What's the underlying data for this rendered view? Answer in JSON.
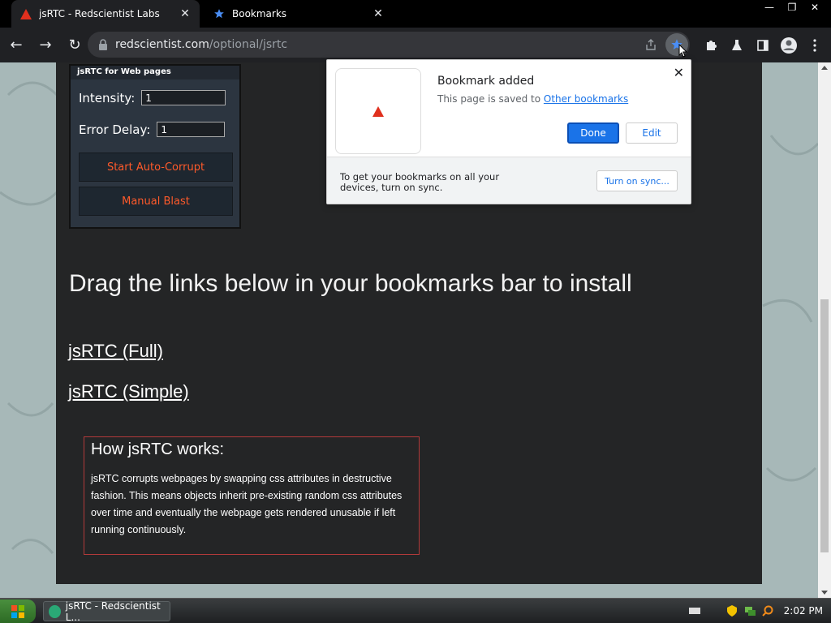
{
  "tabs": [
    {
      "title": "jsRTC - Redscientist Labs",
      "active": true
    },
    {
      "title": "Bookmarks",
      "active": false
    }
  ],
  "window_buttons": {
    "minimize": "—",
    "restore": "❐",
    "close": "✕"
  },
  "address_bar": {
    "domain": "redscientist.com",
    "path": "/optional/jsrtc"
  },
  "panel": {
    "header": "jsRTC for Web pages",
    "intensity_label": "Intensity:",
    "intensity_value": "1",
    "error_delay_label": "Error Delay:",
    "error_delay_value": "1",
    "auto_corrupt_button": "Start Auto-Corrupt",
    "manual_blast_button": "Manual Blast"
  },
  "heading": "Drag the links below in your bookmarks bar to install",
  "links": {
    "full": "jsRTC (Full)",
    "simple": "jsRTC (Simple)"
  },
  "how_box": {
    "title": "How jsRTC works:",
    "body": "jsRTC corrupts webpages by swapping css attributes in destructive fashion. This means objects inherit pre-existing random css attributes over time and eventually the webpage gets rendered unusable if left running continuously."
  },
  "bookmark_popup": {
    "title": "Bookmark added",
    "message_prefix": "This page is saved to ",
    "folder_link": "Other bookmarks",
    "done_button": "Done",
    "edit_button": "Edit",
    "sync_text": "To get your bookmarks on all your devices, turn on sync.",
    "sync_button": "Turn on sync..."
  },
  "taskbar": {
    "item_label": "jsRTC - Redscientist L...",
    "clock": "2:02 PM"
  },
  "colors": {
    "accent": "#1a73e8",
    "brand_red": "#e0301e",
    "button_text": "#ff5a2a"
  }
}
